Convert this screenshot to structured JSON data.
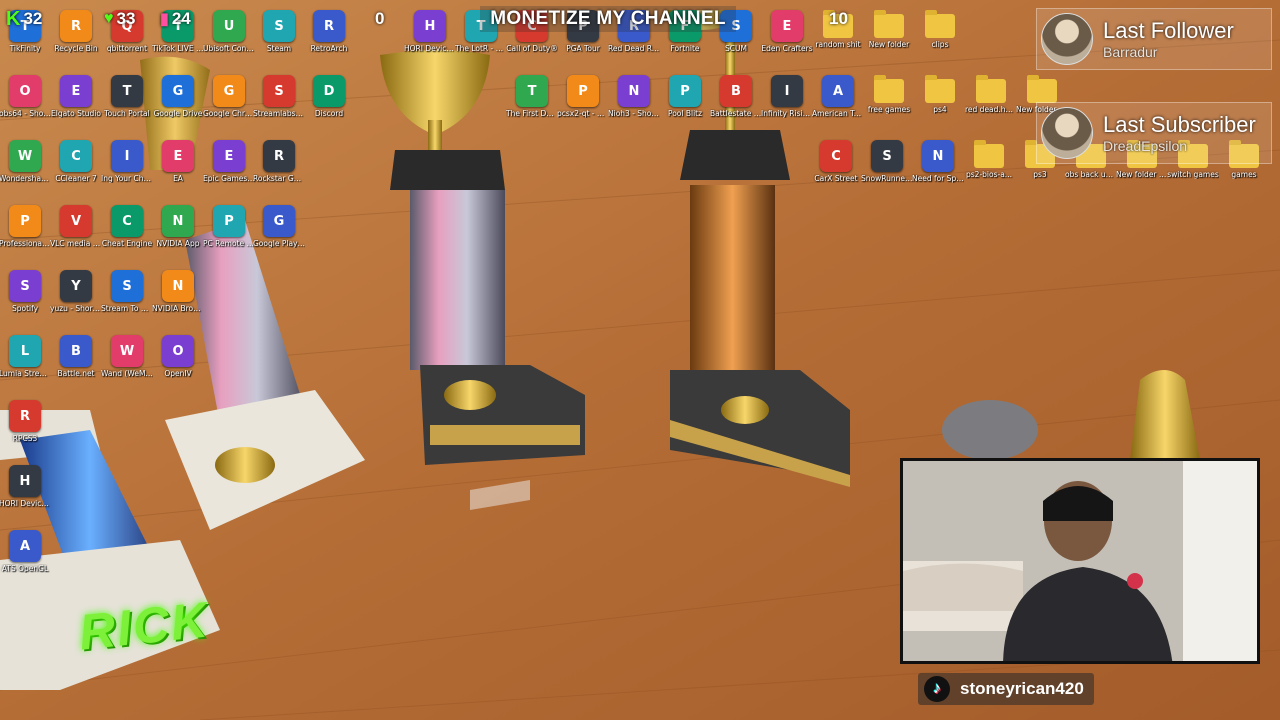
{
  "overlay": {
    "stats": [
      {
        "icon": "kick-icon",
        "value": "32"
      },
      {
        "icon": "viewers-icon",
        "value": "33"
      },
      {
        "icon": "bars-icon",
        "value": "24"
      },
      {
        "icon": "left-counter-icon",
        "value": "0"
      },
      {
        "icon": "right-counter-icon",
        "value": "10"
      }
    ],
    "banner": "MONETIZE MY CHANNEL",
    "last_follower": {
      "label": "Last Follower",
      "name": "Barradur"
    },
    "last_subscriber": {
      "label": "Last Subscriber",
      "name": "DreadEpsilon"
    },
    "tiktok_handle": "stoneyrican420",
    "rick_logo": "RICK"
  },
  "desktop": {
    "col1": [
      "TikFinity",
      "obs64 - Shortcut",
      "Wondershare MirrorGo",
      "Professional Fishing 2 (1)",
      "Spotify",
      "Lumia Stream",
      "RPCS3",
      "HORI Device Manager",
      "ATS OpenGL"
    ],
    "col2": [
      "Recycle Bin",
      "Elgato Studio",
      "CCleaner 7",
      "VLC media player",
      "yuzu - Shortcut",
      "Battle.net"
    ],
    "col3": [
      "qbittorrent",
      "Touch Portal",
      "Ing Your Chrome",
      "Cheat Engine",
      "Stream To Earn",
      "Wand (WeMod)"
    ],
    "col4": [
      "TikTok LIVE Studio",
      "Google Drive",
      "EA",
      "NVIDIA App",
      "NVIDIA Broadcast",
      "OpenIV"
    ],
    "col5": [
      "Ubisoft Connect",
      "Google Chrome",
      "Epic Games Launcher",
      "PC Remote Receiver"
    ],
    "col6": [
      "Steam",
      "Streamlabs Desktop",
      "Rockstar Games",
      "Google Play Games"
    ],
    "col7": [
      "RetroArch",
      "Discord"
    ],
    "top_row": [
      "HORI Device Manager",
      "The LotR - Return t...",
      "Call of Duty®",
      "PGA Tour",
      "Red Dead Redemptio...",
      "Fortnite",
      "SCUM",
      "Eden Crafters",
      "random shit",
      "New folder",
      "clips"
    ],
    "row2": [
      "The First Descendant",
      "pcsx2-qt - Shortcut",
      "Nioh3 - Shortcut",
      "Pool Blitz",
      "Battlestate Games L...",
      "Infinity Rising Launcher",
      "American Truck Si...",
      "free games",
      "ps4",
      "red dead.hack",
      "New folder (2)"
    ],
    "row3": [
      "CarX Street",
      "SnowRunner Windows10",
      "Need for Speed™ ...",
      "ps2-bios-a...",
      "ps3",
      "obs back up folder",
      "New folder (4)",
      "switch games",
      "games"
    ]
  },
  "colors": {
    "kick_green": "#53fc18",
    "wood": "#b8703a",
    "folder_yellow": "#f0c542",
    "rick_green": "#7df13a"
  }
}
